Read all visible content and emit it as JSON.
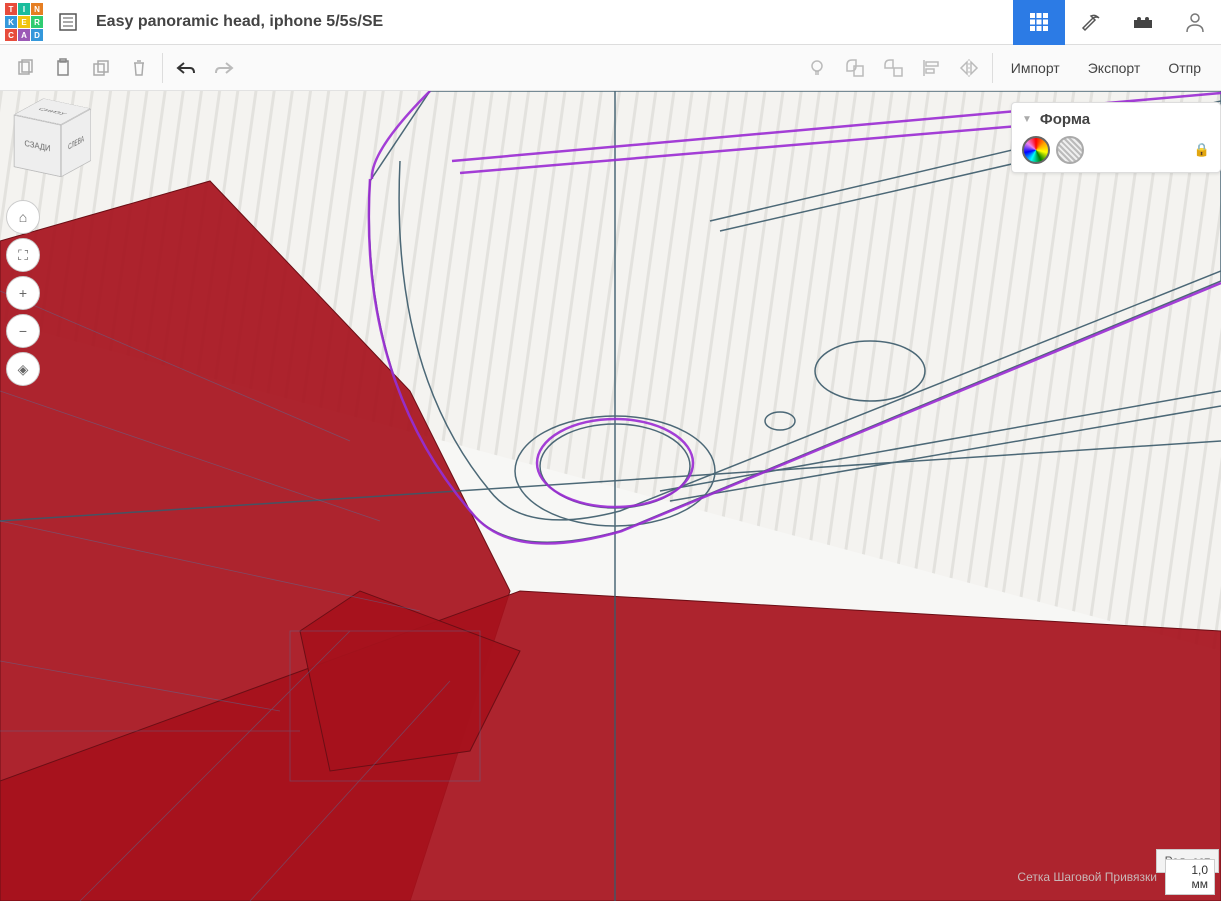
{
  "header": {
    "title": "Easy panoramic head, iphone 5/5s/SE",
    "logo_letters": [
      "T",
      "I",
      "N",
      "K",
      "E",
      "R",
      "C",
      "A",
      "D"
    ]
  },
  "toolbar": {
    "import_label": "Импорт",
    "export_label": "Экспорт",
    "send_label": "Отпр"
  },
  "viewcube": {
    "back": "СЗАДИ",
    "left": "СЛЕВА",
    "bottom": "СНИЗУ"
  },
  "navicons": {
    "home": "⌂",
    "fit": "⛶",
    "zoom_in": "+",
    "zoom_out": "−",
    "ortho": "◈"
  },
  "shape_panel": {
    "title": "Форма"
  },
  "bottom": {
    "edit_grid": "Ред. сет",
    "grid_snap_label": "Сетка Шаговой Привязки",
    "snap_value": "1,0 мм"
  }
}
